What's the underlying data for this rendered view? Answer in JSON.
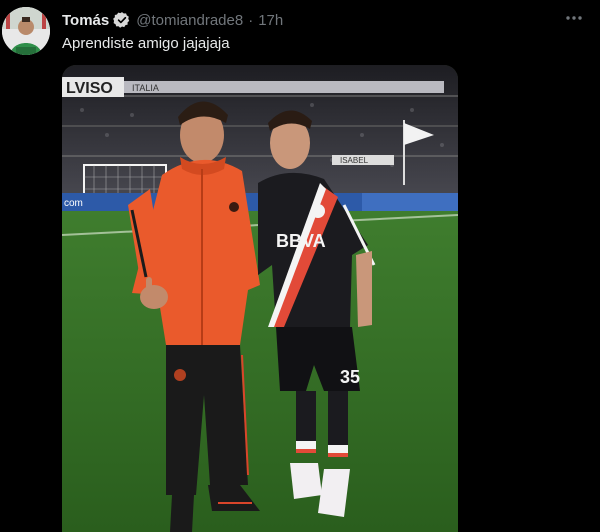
{
  "tweet": {
    "display_name": "Tomás",
    "handle": "@tomiandrade8",
    "separator": "·",
    "time": "17h",
    "text": "Aprendiste amigo jajajaja"
  },
  "icons": {
    "verified": "verified-badge-icon",
    "more": "more-horizontal-icon"
  },
  "colors": {
    "background": "#000000",
    "primary_text": "#e7e9ea",
    "secondary_text": "#71767b",
    "verified_badge": "#d8d8d8"
  },
  "media": {
    "banner_texts": [
      "LVISO",
      "ITALIA",
      "ISABEL",
      "BBVA",
      "35",
      "com"
    ]
  }
}
